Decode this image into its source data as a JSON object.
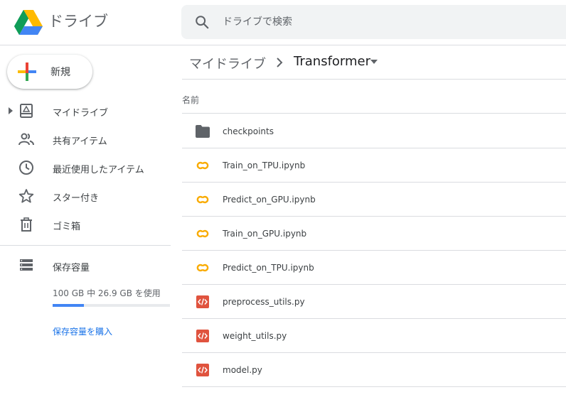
{
  "app": {
    "title": "ドライブ"
  },
  "search": {
    "placeholder": "ドライブで検索"
  },
  "sidebar": {
    "new_label": "新規",
    "items": [
      {
        "label": "マイドライブ",
        "icon": "my-drive-icon"
      },
      {
        "label": "共有アイテム",
        "icon": "shared-icon"
      },
      {
        "label": "最近使用したアイテム",
        "icon": "clock-icon"
      },
      {
        "label": "スター付き",
        "icon": "star-icon"
      },
      {
        "label": "ゴミ箱",
        "icon": "trash-icon"
      }
    ],
    "storage": {
      "title": "保存容量",
      "usage_text": "100 GB 中 26.9 GB を使用",
      "used_fraction": 0.269,
      "buy_label": "保存容量を購入"
    }
  },
  "breadcrumb": {
    "root": "マイドライブ",
    "current": "Transformer"
  },
  "file_list": {
    "column_name": "名前",
    "files": [
      {
        "name": "checkpoints",
        "type": "folder"
      },
      {
        "name": "Train_on_TPU.ipynb",
        "type": "colab"
      },
      {
        "name": "Predict_on_GPU.ipynb",
        "type": "colab"
      },
      {
        "name": "Train_on_GPU.ipynb",
        "type": "colab"
      },
      {
        "name": "Predict_on_TPU.ipynb",
        "type": "colab"
      },
      {
        "name": "preprocess_utils.py",
        "type": "code"
      },
      {
        "name": "weight_utils.py",
        "type": "code"
      },
      {
        "name": "model.py",
        "type": "code"
      }
    ]
  },
  "colors": {
    "accent": "#1a73e8",
    "storage_bar": "#4285f4",
    "folder": "#5f6368",
    "colab": "#f9ab00",
    "code": "#e0533e"
  }
}
